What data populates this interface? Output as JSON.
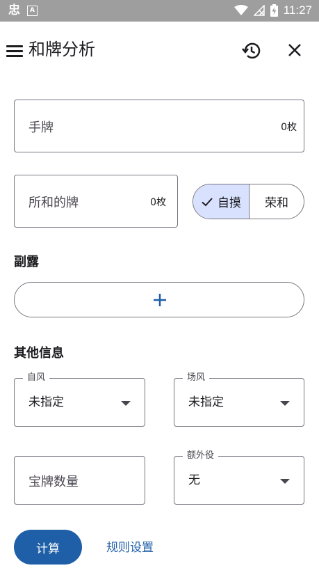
{
  "status_bar": {
    "app_glyph": "忠",
    "notification_glyph": "A",
    "time": "11:27"
  },
  "header": {
    "title": "和牌分析",
    "history_icon": "history-icon",
    "close_icon": "close-icon"
  },
  "hand": {
    "label": "手牌",
    "count": "0枚"
  },
  "winning_tile": {
    "label": "所和的牌",
    "count": "0枚"
  },
  "win_type": {
    "options": [
      "自摸",
      "荣和"
    ],
    "selected": "自摸"
  },
  "melds": {
    "heading": "副露",
    "add_icon": "plus-icon"
  },
  "other_info": {
    "heading": "其他信息",
    "seat_wind": {
      "label": "自风",
      "value": "未指定"
    },
    "round_wind": {
      "label": "场风",
      "value": "未指定"
    },
    "dora_count": {
      "label": "宝牌数量"
    },
    "extra_yaku": {
      "label": "额外役",
      "value": "无"
    }
  },
  "actions": {
    "calculate": "计算",
    "rule_settings": "规则设置"
  },
  "colors": {
    "primary": "#1f5fa8",
    "selected_segment": "#d8e2ff",
    "outline": "#79747e",
    "status_bar": "#9e9e9e"
  }
}
